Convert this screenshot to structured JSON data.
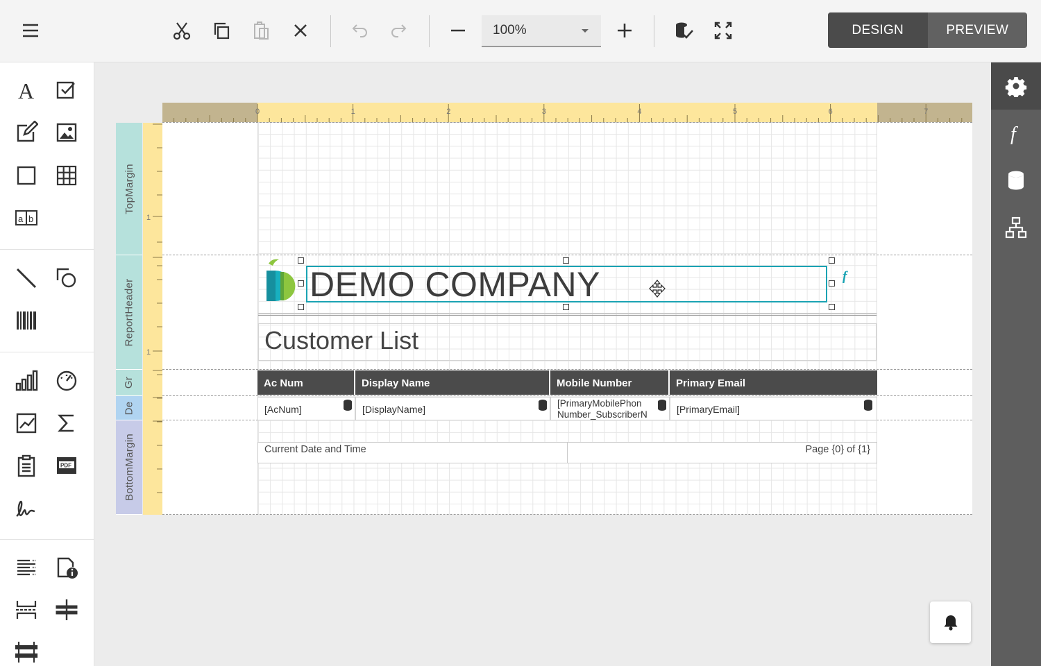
{
  "toolbar": {
    "zoom_value": "100%",
    "mode_design": "DESIGN",
    "mode_preview": "PREVIEW"
  },
  "ruler": {
    "h_ticks": [
      "0",
      "1",
      "2",
      "3",
      "4",
      "5",
      "6",
      "7"
    ],
    "v_tick": "1"
  },
  "bands": {
    "top_margin": "TopMargin",
    "report_header": "ReportHeader",
    "group_header": "Gr",
    "detail": "De",
    "bottom_margin": "BottomMargin"
  },
  "report": {
    "company_name": "DEMO COMPANY",
    "title": "Customer List",
    "columns": [
      "Ac Num",
      "Display Name",
      "Mobile Number",
      "Primary Email"
    ],
    "fields": [
      "[AcNum]",
      "[DisplayName]",
      "[PrimaryMobilePhon",
      "Number_SubscriberN",
      "[PrimaryEmail]"
    ],
    "footer_left": "Current Date and Time",
    "footer_right": "Page {0} of {1}"
  },
  "colors": {
    "accent": "#1aa3b3",
    "header_fill": "#4b4b4b",
    "ruler_active": "#fde69c",
    "ruler_inactive": "#c2b48f"
  }
}
